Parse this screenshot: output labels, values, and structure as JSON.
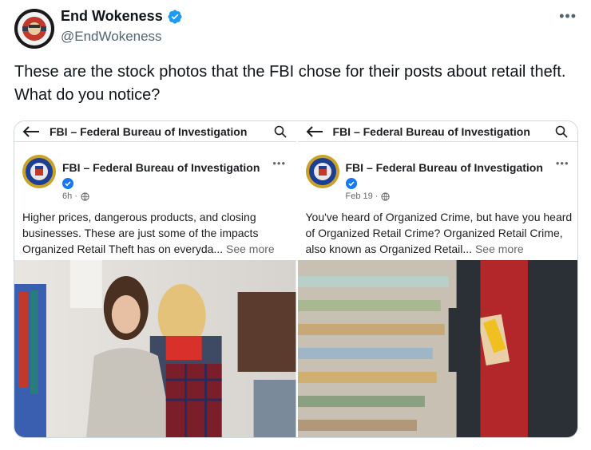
{
  "tweet": {
    "author_name": "End Wokeness",
    "handle": "@EndWokeness",
    "more_label": "•••",
    "text": "These are the stock photos that the FBI chose for their posts about retail theft. What do you notice?"
  },
  "colors": {
    "verified_blue": "#1d9bf0",
    "text_primary": "#0f1419",
    "text_secondary": "#536471",
    "fb_meta": "#65676b"
  },
  "posts": [
    {
      "bar_title": "FBI – Federal Bureau of Investigation",
      "page_name": "FBI – Federal Bureau of Investigation",
      "time": "6h ·",
      "dots": "•••",
      "body": "Higher prices, dangerous products, and closing businesses. These are just some of the impacts Organized Retail Theft has on everyda...",
      "see_more": "See more"
    },
    {
      "bar_title": "FBI – Federal Bureau of Investigation",
      "page_name": "FBI – Federal Bureau of Investigation",
      "time": "Feb 19 ·",
      "dots": "•••",
      "body": "You've heard of Organized Crime, but have you heard of Organized Retail Crime? Organized Retail Crime, also known as Organized Retail...",
      "see_more": "See more"
    }
  ],
  "icons": {
    "avatar": "avatar-image",
    "verified": "verified-badge-icon",
    "back": "back-arrow-icon",
    "search": "search-icon",
    "globe": "globe-icon",
    "seal": "fbi-seal-icon"
  }
}
